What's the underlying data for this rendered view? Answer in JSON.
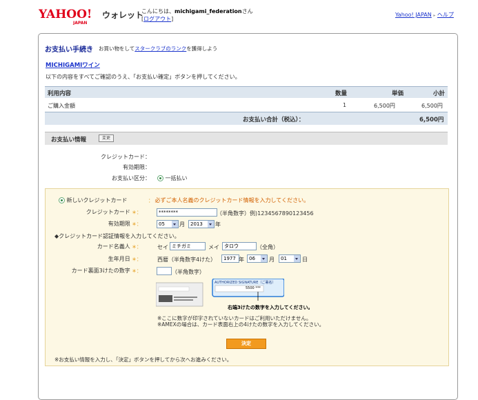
{
  "header": {
    "logo_text": "YAHOO! JAPAN",
    "wallet_label": "ウォレット",
    "greeting_prefix": "こんにちは、",
    "username": "michigami_federation",
    "greeting_suffix": "さん",
    "logout_open": "[",
    "logout_label": "ログアウト",
    "logout_close": "]",
    "link_yahoo": "Yahoo! JAPAN",
    "link_help": "ヘルプ"
  },
  "page": {
    "title": "お支払い手続き",
    "subtitle_prefix": "お買い物をして",
    "subtitle_link": "スタークラブのランク",
    "subtitle_suffix": "を獲得しよう",
    "shop_name": "MICHIGAMIワイン",
    "instruction": "以下の内容をすべてご確認のうえ、「お支払い確定」ボタンを押してください。"
  },
  "table": {
    "headers": {
      "item": "利用内容",
      "qty": "数量",
      "unit": "単価",
      "subtotal": "小計"
    },
    "rows": [
      {
        "item": "ご購入金額",
        "qty": "1",
        "unit": "6,500円",
        "subtotal": "6,500円"
      }
    ],
    "total_label": "お支払い合計（税込）：",
    "total_value": "6,500円"
  },
  "payment_info": {
    "section_title": "お支払い情報",
    "change_label": "変更",
    "credit_card_label": "クレジットカード：",
    "expiry_label": "有効期限：",
    "payment_type_label": "お支払い区分：",
    "payment_type_value": "一括払い"
  },
  "card_form": {
    "new_card_label": "新しいクレジットカード",
    "new_card_notice": "必ずご本人名義のクレジットカード情報を入力してください。",
    "card_number_label": "クレジットカード",
    "card_number_value": "********",
    "card_number_hint": "（半角数字）例)1234567890123456",
    "expiry_label": "有効期限",
    "expiry_month": "05",
    "month_unit": "月",
    "expiry_year": "2013",
    "year_unit": "年",
    "auth_heading": "◆クレジットカード認証情報を入力してください。",
    "holder_label": "カード名義人",
    "sei_label": "セイ",
    "sei_value": "ミチガミ",
    "mei_label": "メイ",
    "mei_value": "タロウ",
    "holder_hint": "（全角）",
    "birth_label": "生年月日",
    "birth_prefix": "西暦（半角数字4けた）",
    "birth_year": "1977",
    "birth_year_unit": "年",
    "birth_month": "06",
    "birth_month_unit": "月",
    "birth_day": "01",
    "birth_day_unit": "日",
    "cvv_label": "カード裏面3けたの数字",
    "cvv_hint": "（半角数字）",
    "signature_caption": "AUTHORIZED SIGNATURE（ご署名）",
    "signature_digits": "5500 ***",
    "cvv_pointer_text": "右端3けたの数字を入力してください。",
    "note1": "※ここに数字が印字されていないカードはご利用いただけません。",
    "note2": "※AMEXの場合は、カード表面右上の4けたの数字を入力してください。",
    "decide_label": "決定",
    "footer_note": "※お支払い情報を入力し、「決定」ボタンを押してから次へお進みください。"
  },
  "colors": {
    "accent": "#1a2a99",
    "warn": "#d26000",
    "button": "#f29a1f"
  }
}
